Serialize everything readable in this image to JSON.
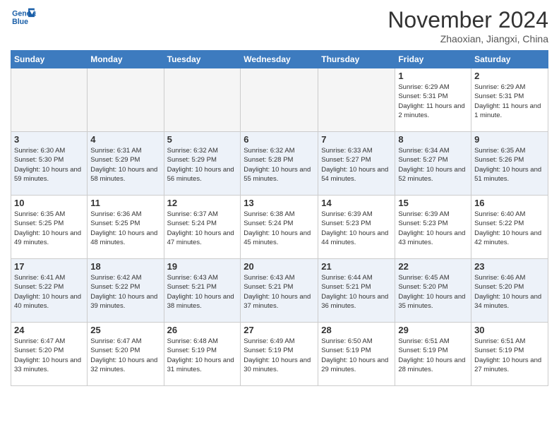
{
  "header": {
    "logo_line1": "General",
    "logo_line2": "Blue",
    "month": "November 2024",
    "location": "Zhaoxian, Jiangxi, China"
  },
  "days_of_week": [
    "Sunday",
    "Monday",
    "Tuesday",
    "Wednesday",
    "Thursday",
    "Friday",
    "Saturday"
  ],
  "weeks": [
    [
      {
        "num": "",
        "info": ""
      },
      {
        "num": "",
        "info": ""
      },
      {
        "num": "",
        "info": ""
      },
      {
        "num": "",
        "info": ""
      },
      {
        "num": "",
        "info": ""
      },
      {
        "num": "1",
        "info": "Sunrise: 6:29 AM\nSunset: 5:31 PM\nDaylight: 11 hours and 2 minutes."
      },
      {
        "num": "2",
        "info": "Sunrise: 6:29 AM\nSunset: 5:31 PM\nDaylight: 11 hours and 1 minute."
      }
    ],
    [
      {
        "num": "3",
        "info": "Sunrise: 6:30 AM\nSunset: 5:30 PM\nDaylight: 10 hours and 59 minutes."
      },
      {
        "num": "4",
        "info": "Sunrise: 6:31 AM\nSunset: 5:29 PM\nDaylight: 10 hours and 58 minutes."
      },
      {
        "num": "5",
        "info": "Sunrise: 6:32 AM\nSunset: 5:29 PM\nDaylight: 10 hours and 56 minutes."
      },
      {
        "num": "6",
        "info": "Sunrise: 6:32 AM\nSunset: 5:28 PM\nDaylight: 10 hours and 55 minutes."
      },
      {
        "num": "7",
        "info": "Sunrise: 6:33 AM\nSunset: 5:27 PM\nDaylight: 10 hours and 54 minutes."
      },
      {
        "num": "8",
        "info": "Sunrise: 6:34 AM\nSunset: 5:27 PM\nDaylight: 10 hours and 52 minutes."
      },
      {
        "num": "9",
        "info": "Sunrise: 6:35 AM\nSunset: 5:26 PM\nDaylight: 10 hours and 51 minutes."
      }
    ],
    [
      {
        "num": "10",
        "info": "Sunrise: 6:35 AM\nSunset: 5:25 PM\nDaylight: 10 hours and 49 minutes."
      },
      {
        "num": "11",
        "info": "Sunrise: 6:36 AM\nSunset: 5:25 PM\nDaylight: 10 hours and 48 minutes."
      },
      {
        "num": "12",
        "info": "Sunrise: 6:37 AM\nSunset: 5:24 PM\nDaylight: 10 hours and 47 minutes."
      },
      {
        "num": "13",
        "info": "Sunrise: 6:38 AM\nSunset: 5:24 PM\nDaylight: 10 hours and 45 minutes."
      },
      {
        "num": "14",
        "info": "Sunrise: 6:39 AM\nSunset: 5:23 PM\nDaylight: 10 hours and 44 minutes."
      },
      {
        "num": "15",
        "info": "Sunrise: 6:39 AM\nSunset: 5:23 PM\nDaylight: 10 hours and 43 minutes."
      },
      {
        "num": "16",
        "info": "Sunrise: 6:40 AM\nSunset: 5:22 PM\nDaylight: 10 hours and 42 minutes."
      }
    ],
    [
      {
        "num": "17",
        "info": "Sunrise: 6:41 AM\nSunset: 5:22 PM\nDaylight: 10 hours and 40 minutes."
      },
      {
        "num": "18",
        "info": "Sunrise: 6:42 AM\nSunset: 5:22 PM\nDaylight: 10 hours and 39 minutes."
      },
      {
        "num": "19",
        "info": "Sunrise: 6:43 AM\nSunset: 5:21 PM\nDaylight: 10 hours and 38 minutes."
      },
      {
        "num": "20",
        "info": "Sunrise: 6:43 AM\nSunset: 5:21 PM\nDaylight: 10 hours and 37 minutes."
      },
      {
        "num": "21",
        "info": "Sunrise: 6:44 AM\nSunset: 5:21 PM\nDaylight: 10 hours and 36 minutes."
      },
      {
        "num": "22",
        "info": "Sunrise: 6:45 AM\nSunset: 5:20 PM\nDaylight: 10 hours and 35 minutes."
      },
      {
        "num": "23",
        "info": "Sunrise: 6:46 AM\nSunset: 5:20 PM\nDaylight: 10 hours and 34 minutes."
      }
    ],
    [
      {
        "num": "24",
        "info": "Sunrise: 6:47 AM\nSunset: 5:20 PM\nDaylight: 10 hours and 33 minutes."
      },
      {
        "num": "25",
        "info": "Sunrise: 6:47 AM\nSunset: 5:20 PM\nDaylight: 10 hours and 32 minutes."
      },
      {
        "num": "26",
        "info": "Sunrise: 6:48 AM\nSunset: 5:19 PM\nDaylight: 10 hours and 31 minutes."
      },
      {
        "num": "27",
        "info": "Sunrise: 6:49 AM\nSunset: 5:19 PM\nDaylight: 10 hours and 30 minutes."
      },
      {
        "num": "28",
        "info": "Sunrise: 6:50 AM\nSunset: 5:19 PM\nDaylight: 10 hours and 29 minutes."
      },
      {
        "num": "29",
        "info": "Sunrise: 6:51 AM\nSunset: 5:19 PM\nDaylight: 10 hours and 28 minutes."
      },
      {
        "num": "30",
        "info": "Sunrise: 6:51 AM\nSunset: 5:19 PM\nDaylight: 10 hours and 27 minutes."
      }
    ]
  ]
}
